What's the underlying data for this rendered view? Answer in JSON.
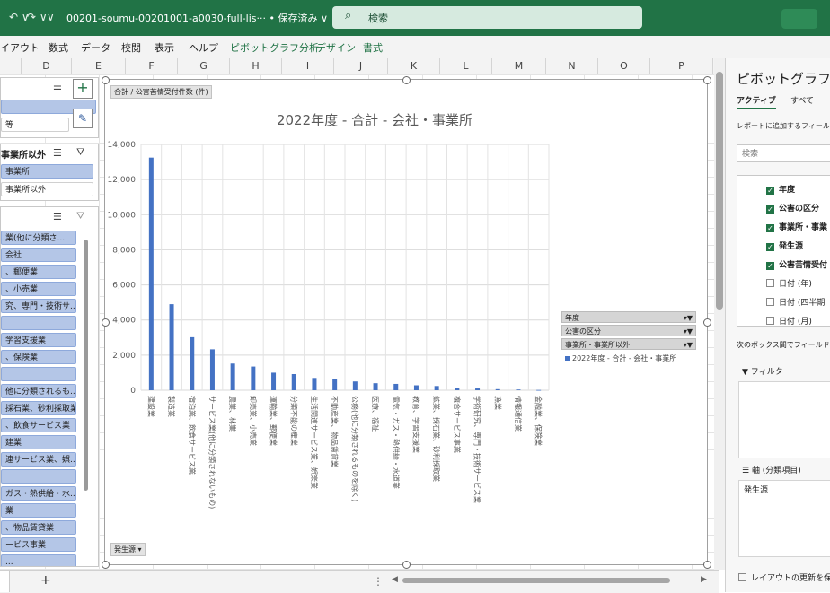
{
  "titlebar": {
    "doc_title": "00201-soumu-00201001-a0030-full-lis··· • 保存済み ∨",
    "search_placeholder": "検索",
    "undo_glyph": "↶ ∨",
    "redo_glyph": "↷ ∨",
    "qa_glyph": "⊽"
  },
  "menubar": {
    "items": [
      "イアウト",
      "数式",
      "データ",
      "校閲",
      "表示",
      "ヘルプ",
      "ピボットグラフ分析",
      "デザイン",
      "書式"
    ]
  },
  "columns": [
    "D",
    "E",
    "F",
    "G",
    "H",
    "I",
    "J",
    "K",
    "L",
    "M",
    "N",
    "O",
    "P"
  ],
  "slicers": {
    "top_items": [
      "",
      "等"
    ],
    "mid_title": "事業所以外",
    "mid_items": [
      "事業所",
      "事業所以外"
    ],
    "bottom_items": [
      "業(他に分類さ...",
      "会社",
      "、郵便業",
      "、小売業",
      "究、専門・技術サ...",
      "",
      "学習支援業",
      "、保険業",
      "",
      "他に分類されるも...",
      "採石業、砂利採取業",
      "、飲食サービス業",
      "建業",
      "連サービス業、娯...",
      "",
      "ガス・熱供給・水...",
      "業",
      "、物品賃貸業",
      "ービス事業",
      "..."
    ]
  },
  "chart": {
    "field_button_top": "合計 / 公害苦情受付件数 (件)",
    "field_button_bottom": "発生源 ▾",
    "legend_buttons": [
      "年度",
      "公害の区分",
      "事業所・事業所以外"
    ],
    "legend_arrow": "▾▼"
  },
  "chart_data": {
    "type": "bar",
    "title": "2022年度 - 合計 - 会社・事業所",
    "xlabel": "",
    "ylabel": "",
    "ylim": [
      0,
      14000
    ],
    "yticks": [
      "0",
      "2,000",
      "4,000",
      "6,000",
      "8,000",
      "10,000",
      "12,000",
      "14,000"
    ],
    "grid": true,
    "legend": "right",
    "categories": [
      "建設業",
      "製造業",
      "宿泊業、飲食サービス業",
      "サービス業(他に分類されないもの)",
      "農業、林業",
      "卸売業、小売業",
      "運輸業、郵便業",
      "分類不能の産業",
      "生活関連サービス業、娯楽業",
      "不動産業、物品賃貸業",
      "公務(他に分類されるものを除く)",
      "医療、福祉",
      "電気・ガス・熱供給・水道業",
      "教育、学習支援業",
      "鉱業、採石業、砂利採取業",
      "複合サービス事業",
      "学術研究、専門・技術サービス業",
      "漁業",
      "情報通信業",
      "金融業、保険業"
    ],
    "series": [
      {
        "name": "2022年度 - 合計 - 会社・事業所",
        "color": "#4472c4",
        "values": [
          13250,
          4900,
          3020,
          2330,
          1520,
          1350,
          1000,
          920,
          700,
          660,
          500,
          400,
          360,
          280,
          240,
          150,
          100,
          60,
          40,
          15
        ]
      }
    ]
  },
  "taskpane": {
    "title": "ピボットグラフの",
    "tabs": [
      "アクティブ",
      "すべて"
    ],
    "hint": "レポートに追加するフィール",
    "search_placeholder": "検索",
    "fields": [
      {
        "label": "年度",
        "checked": true
      },
      {
        "label": "公害の区分",
        "checked": true
      },
      {
        "label": "事業所・事業",
        "checked": true
      },
      {
        "label": "発生源",
        "checked": true
      },
      {
        "label": "公害苦情受付",
        "checked": true
      },
      {
        "label": "日付 (年)",
        "checked": false
      },
      {
        "label": "日付 (四半期",
        "checked": false
      },
      {
        "label": "日付 (月)",
        "checked": false
      }
    ],
    "between_label": "次のボックス間でフィールド",
    "filter_label": "フィルター",
    "axis_label": "軸 (分類項目)",
    "axis_item": "発生源",
    "defer_label": "レイアウトの更新を保"
  },
  "statusbar": {
    "add_sheet": "+",
    "more_dots": "⋮"
  }
}
